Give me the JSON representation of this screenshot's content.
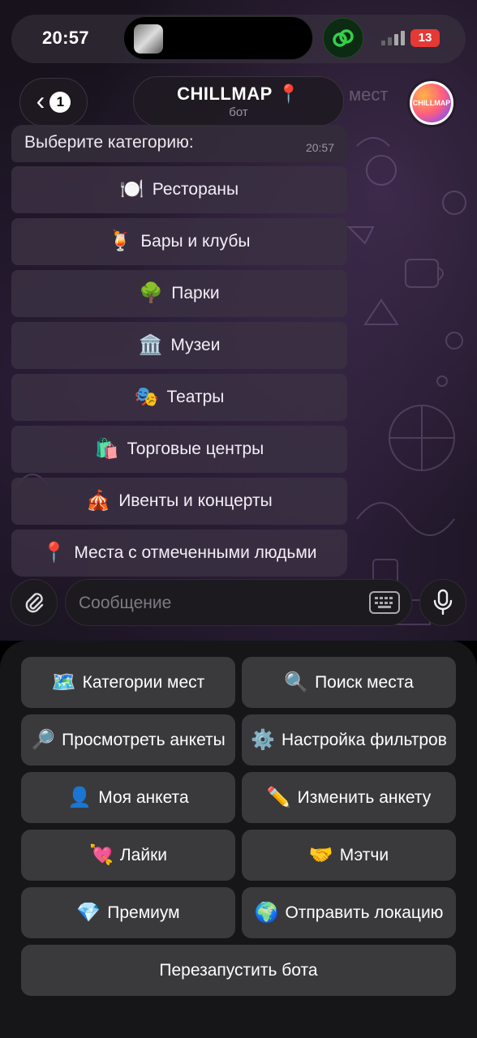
{
  "status_bar": {
    "time": "20:57",
    "battery": "13"
  },
  "header": {
    "back_badge": "1",
    "title": "CHILLMAP 📍",
    "subtitle": "бот",
    "background_text": "мест",
    "avatar_text": "CHILLMAP"
  },
  "message": {
    "text": "Выберите категорию:",
    "time": "20:57"
  },
  "inline_keyboard": [
    {
      "emoji": "🍽️",
      "label": "Рестораны"
    },
    {
      "emoji": "🍹",
      "label": "Бары и клубы"
    },
    {
      "emoji": "🌳",
      "label": "Парки"
    },
    {
      "emoji": "🏛️",
      "label": "Музеи"
    },
    {
      "emoji": "🎭",
      "label": "Театры"
    },
    {
      "emoji": "🛍️",
      "label": "Торговые центры"
    },
    {
      "emoji": "🎪",
      "label": "Ивенты и концерты"
    },
    {
      "emoji": "📍",
      "label": "Места с отмеченными людьми"
    }
  ],
  "input": {
    "placeholder": "Сообщение"
  },
  "reply_keyboard": [
    {
      "emoji": "🗺️",
      "label": "Категории мест"
    },
    {
      "emoji": "🔍",
      "label": "Поиск места"
    },
    {
      "emoji": "🔎",
      "label": "Просмотреть анкеты"
    },
    {
      "emoji": "⚙️",
      "label": "Настройка фильтров"
    },
    {
      "emoji": "👤",
      "label": "Моя анкета"
    },
    {
      "emoji": "✏️",
      "label": "Изменить анкету"
    },
    {
      "emoji": "💘",
      "label": "Лайки"
    },
    {
      "emoji": "🤝",
      "label": "Мэтчи"
    },
    {
      "emoji": "💎",
      "label": "Премиум"
    },
    {
      "emoji": "🌍",
      "label": "Отправить локацию"
    },
    {
      "emoji": "",
      "label": "Перезапустить бота"
    }
  ]
}
